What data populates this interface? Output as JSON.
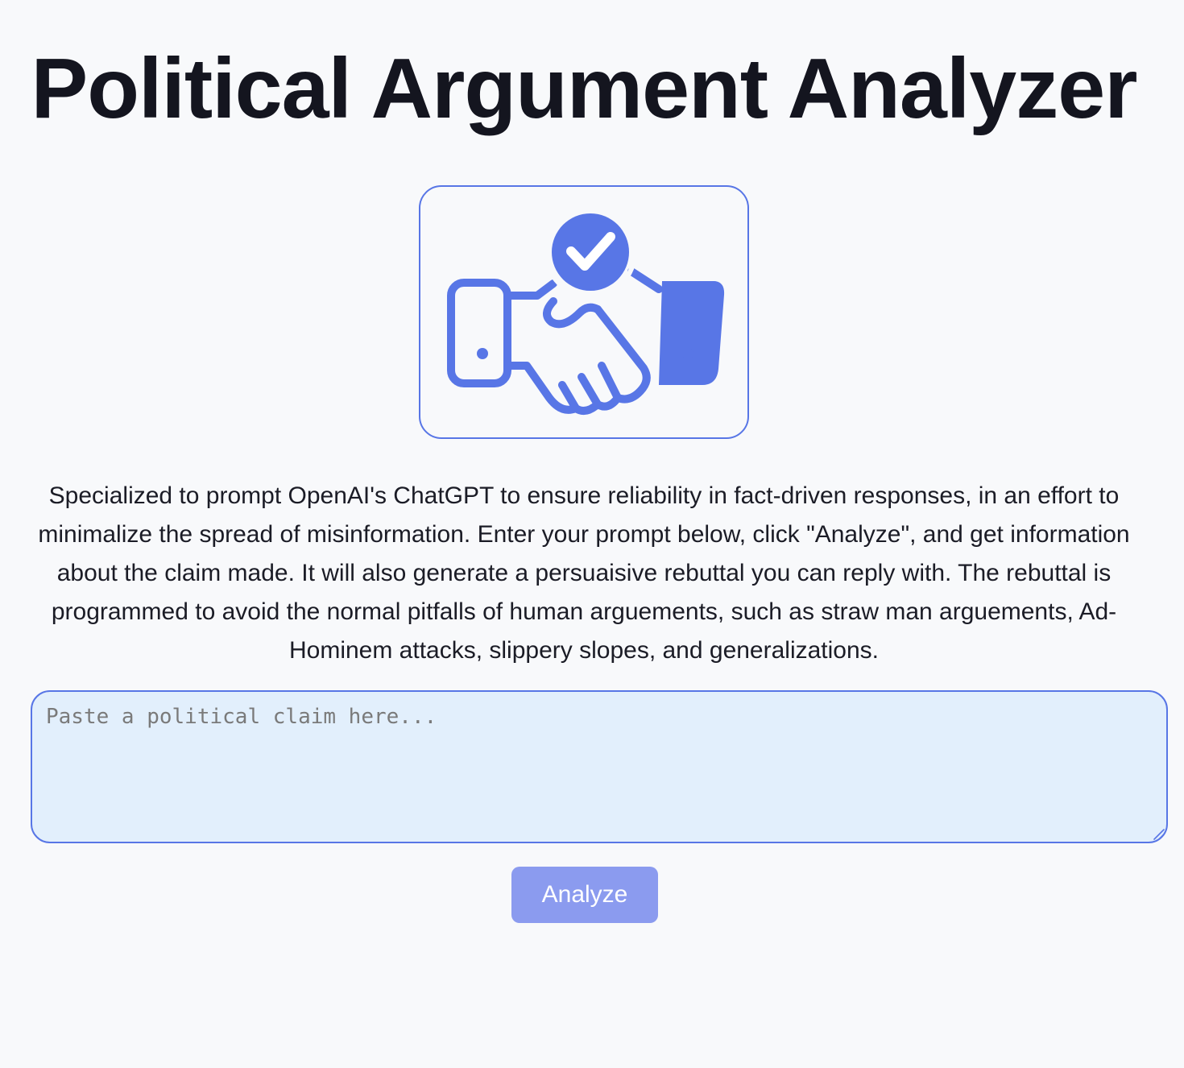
{
  "header": {
    "title": "Political Argument Analyzer"
  },
  "logo": {
    "icon": "handshake-check-icon",
    "color": "#5876e6"
  },
  "description": "Specialized to prompt OpenAI's ChatGPT to ensure reliability in fact-driven responses, in an effort to minimalize the spread of misinformation. Enter your prompt below, click \"Analyze\", and get information about the claim made. It will also generate a persuaisive rebuttal you can reply with. The rebuttal is programmed to avoid the normal pitfalls of human arguements, such as straw man arguements, Ad-Hominem attacks, slippery slopes, and generalizations.",
  "claim_input": {
    "value": "",
    "placeholder": "Paste a political claim here..."
  },
  "analyze_button": {
    "label": "Analyze",
    "color": "#8b9bef"
  },
  "colors": {
    "accent": "#5876e6",
    "background": "#f8f9fb",
    "input_background": "#e2effc"
  }
}
